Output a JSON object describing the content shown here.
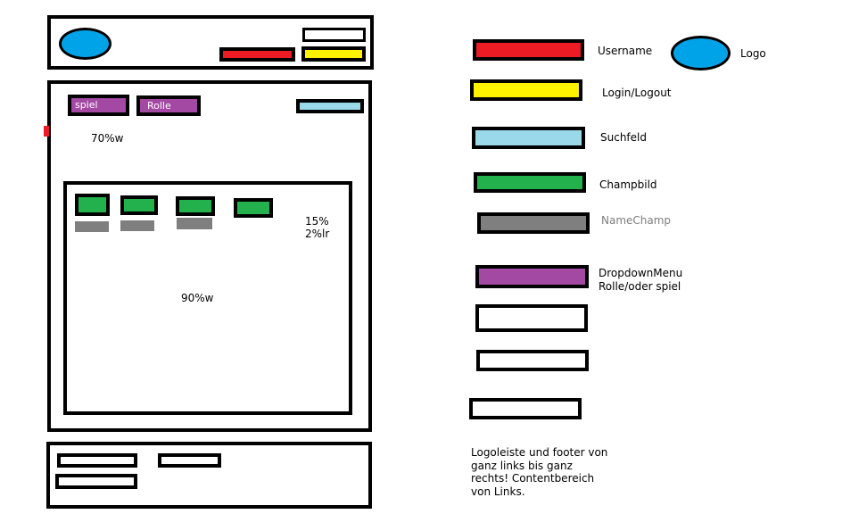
{
  "wireframe": {
    "header": {
      "logo": {
        "icon": "logo-ellipse",
        "color": "#00a2e8"
      },
      "username_bar_color": "#ed1c24",
      "login_logout_bar_color": "#fff200"
    },
    "content": {
      "dropdown_spiel": "spiel",
      "dropdown_rolle": "Rolle",
      "search_bar_color": "#99d9ea",
      "width_label_outer": "70%w",
      "inner": {
        "width_label": "90%w",
        "margin_label_line1": "15%",
        "margin_label_line2": "2%lr"
      }
    }
  },
  "legend": {
    "items": [
      {
        "label": "Username",
        "color": "#ed1c24"
      },
      {
        "label": "Login/Logout",
        "color": "#fff200"
      },
      {
        "label": "Suchfeld",
        "color": "#99d9ea"
      },
      {
        "label": "Champbild",
        "color": "#22b14c"
      },
      {
        "label": "NameChamp",
        "color": "#7f7f7f"
      },
      {
        "label_line1": "DropdownMenu",
        "label_line2": "Rolle/oder spiel",
        "color": "#a349a4"
      }
    ],
    "logo_label": "Logo"
  },
  "note": {
    "line1": "Logoleiste und footer von",
    "line2": "ganz links bis ganz",
    "line3": "rechts! Contentbereich",
    "line4": "von Links."
  }
}
